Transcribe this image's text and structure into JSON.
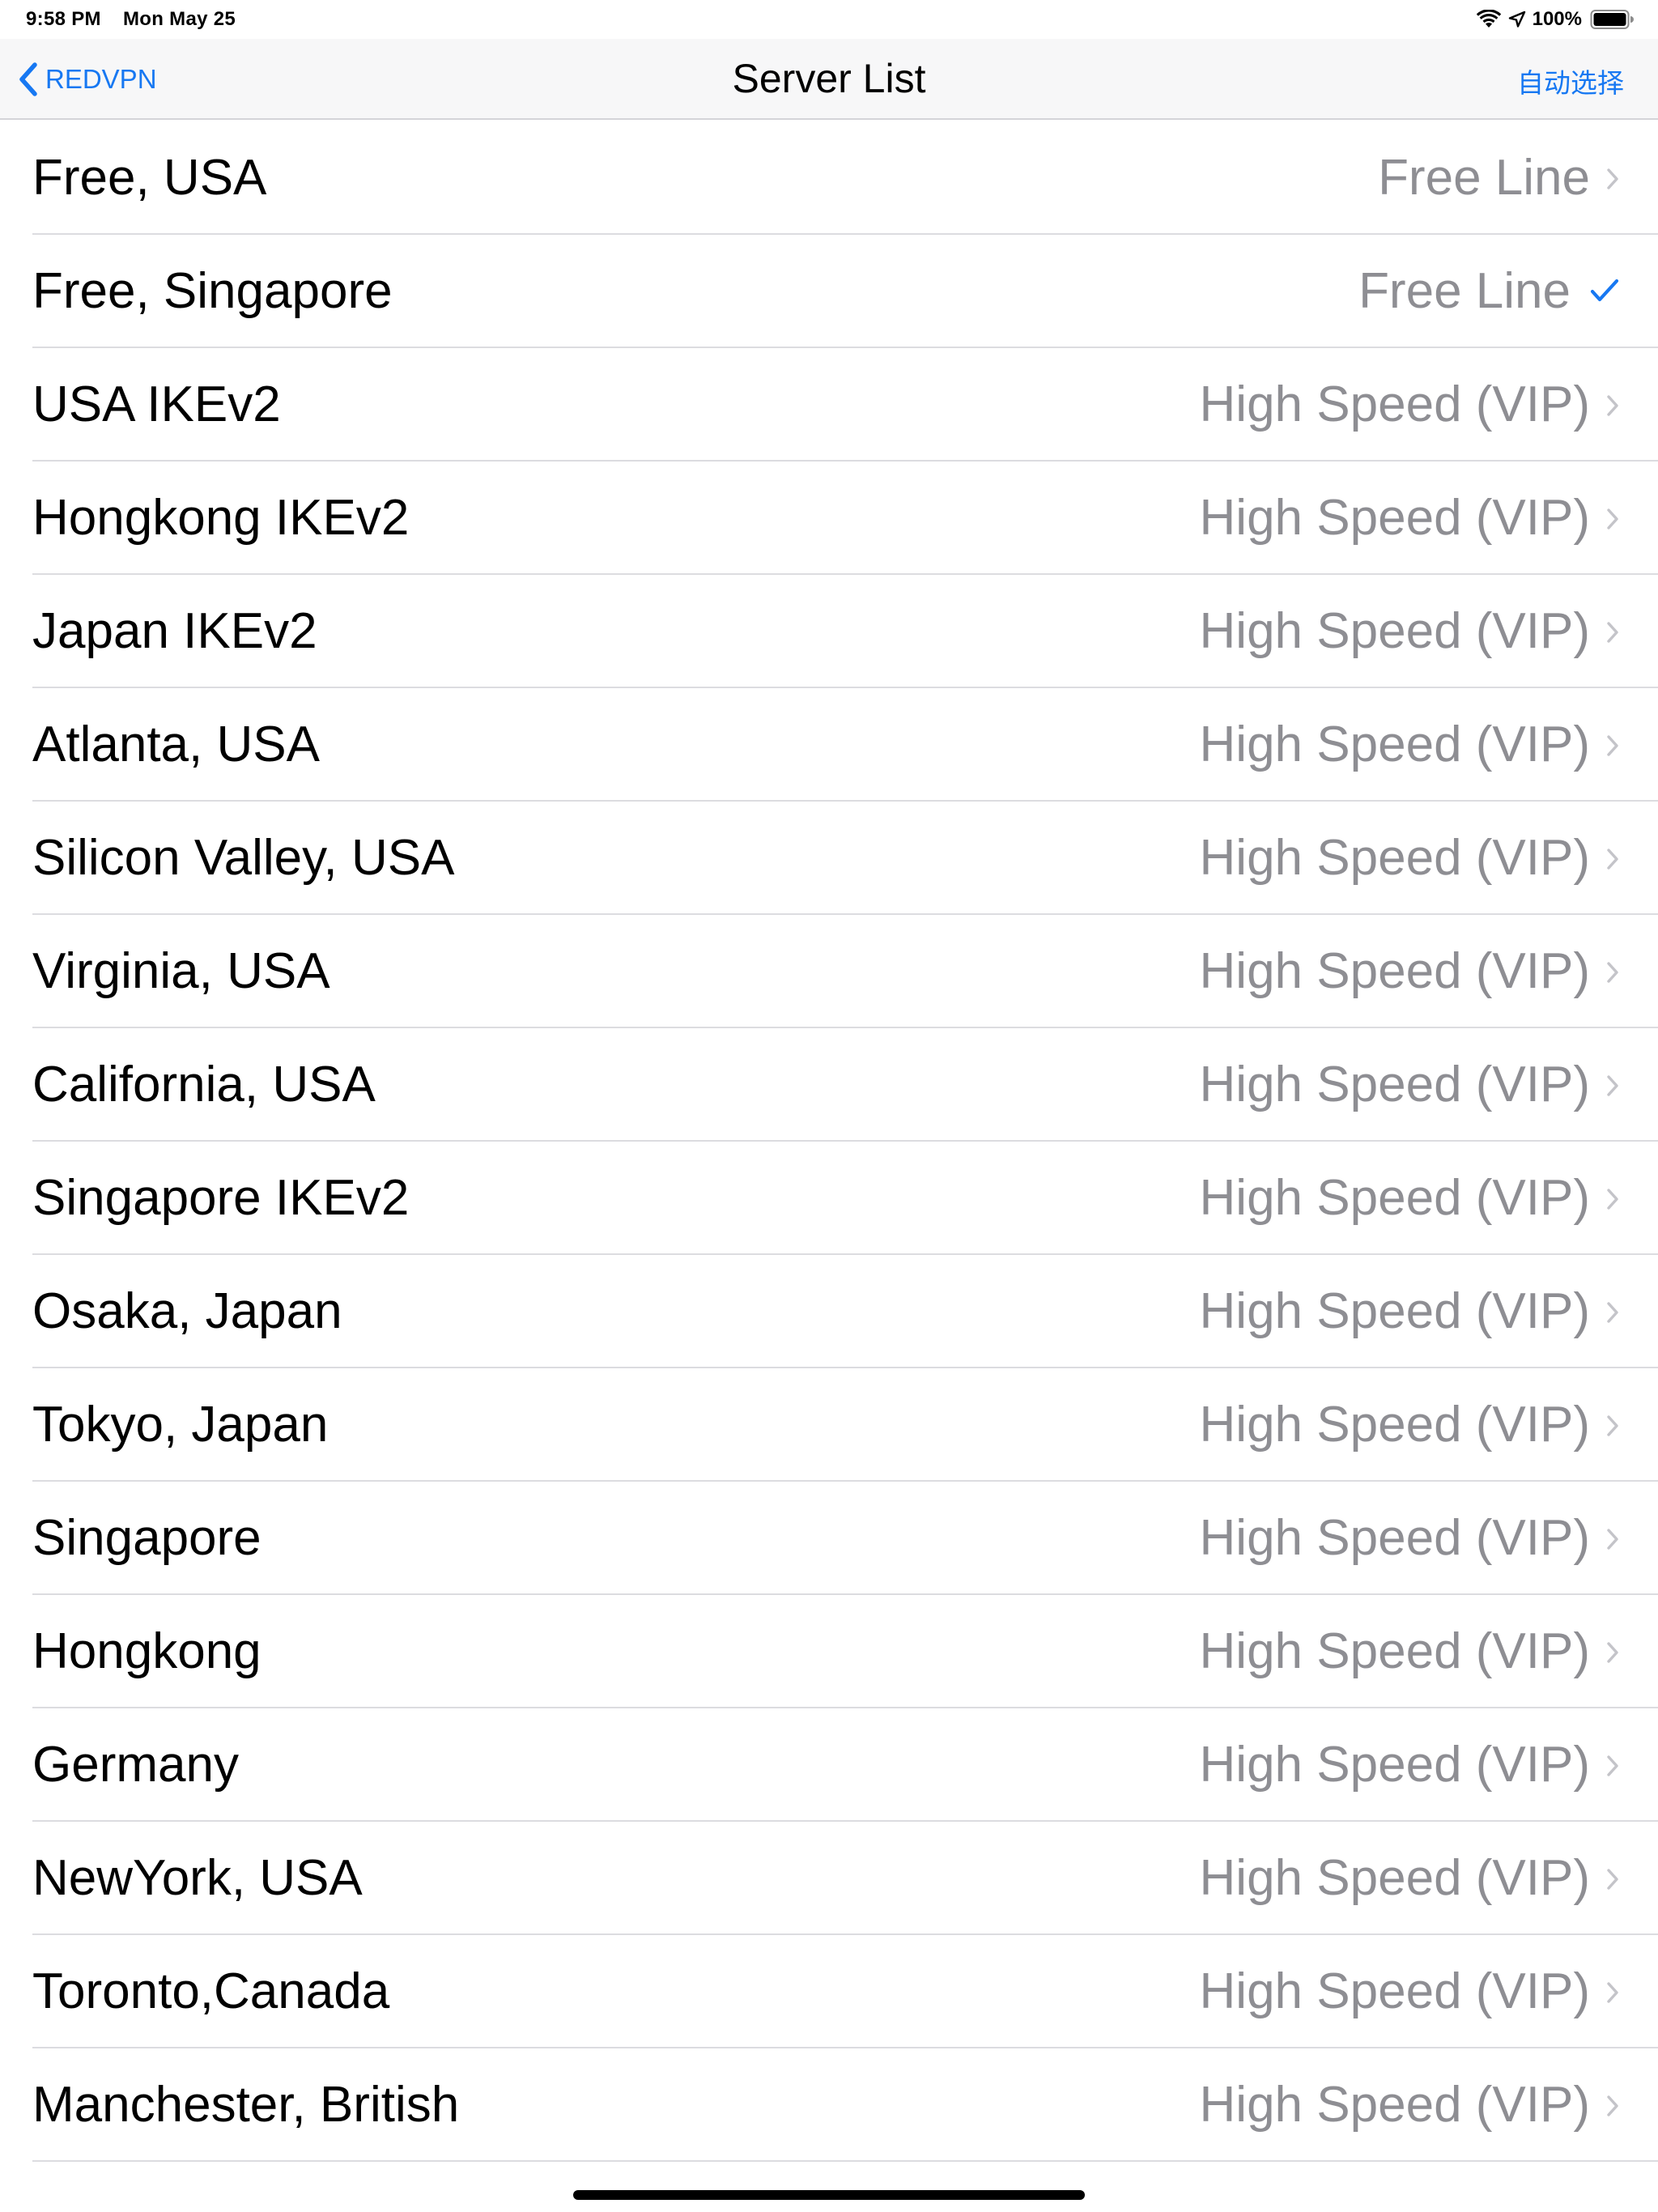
{
  "status_bar": {
    "time": "9:58 PM",
    "date": "Mon May 25",
    "battery": "100%",
    "icons": [
      "wifi-icon",
      "location-arrow-icon",
      "battery-icon"
    ]
  },
  "nav": {
    "back_label": "REDVPN",
    "title": "Server List",
    "right_button": "自动选择"
  },
  "colors": {
    "accent": "#1778f2",
    "detail_text": "#8e8e93",
    "separator": "#dcdce0",
    "nav_background": "#f7f7f8"
  },
  "servers": [
    {
      "name": "Free, USA",
      "detail": "Free Line",
      "accessory": "chevron-right-icon"
    },
    {
      "name": "Free, Singapore",
      "detail": "Free Line",
      "accessory": "checkmark-icon"
    },
    {
      "name": "USA IKEv2",
      "detail": "High Speed (VIP)",
      "accessory": "chevron-right-icon"
    },
    {
      "name": "Hongkong IKEv2",
      "detail": "High Speed (VIP)",
      "accessory": "chevron-right-icon"
    },
    {
      "name": "Japan IKEv2",
      "detail": "High Speed (VIP)",
      "accessory": "chevron-right-icon"
    },
    {
      "name": "Atlanta, USA",
      "detail": "High Speed (VIP)",
      "accessory": "chevron-right-icon"
    },
    {
      "name": "Silicon Valley, USA",
      "detail": "High Speed (VIP)",
      "accessory": "chevron-right-icon"
    },
    {
      "name": "Virginia, USA",
      "detail": "High Speed (VIP)",
      "accessory": "chevron-right-icon"
    },
    {
      "name": "California, USA",
      "detail": "High Speed (VIP)",
      "accessory": "chevron-right-icon"
    },
    {
      "name": "Singapore IKEv2",
      "detail": "High Speed (VIP)",
      "accessory": "chevron-right-icon"
    },
    {
      "name": "Osaka, Japan",
      "detail": "High Speed (VIP)",
      "accessory": "chevron-right-icon"
    },
    {
      "name": "Tokyo, Japan",
      "detail": "High Speed (VIP)",
      "accessory": "chevron-right-icon"
    },
    {
      "name": "Singapore",
      "detail": "High Speed (VIP)",
      "accessory": "chevron-right-icon"
    },
    {
      "name": "Hongkong",
      "detail": "High Speed (VIP)",
      "accessory": "chevron-right-icon"
    },
    {
      "name": "Germany",
      "detail": "High Speed (VIP)",
      "accessory": "chevron-right-icon"
    },
    {
      "name": "NewYork, USA",
      "detail": "High Speed (VIP)",
      "accessory": "chevron-right-icon"
    },
    {
      "name": "Toronto,Canada",
      "detail": "High Speed (VIP)",
      "accessory": "chevron-right-icon"
    },
    {
      "name": "Manchester, British",
      "detail": "High Speed (VIP)",
      "accessory": "chevron-right-icon"
    }
  ]
}
